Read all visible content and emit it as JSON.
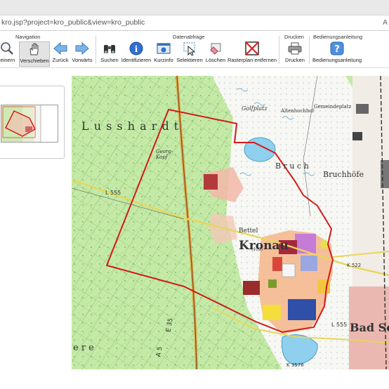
{
  "browser": {
    "url": "kro.jsp?project=kro_public&view=kro_public",
    "reader_icon": "A"
  },
  "toolbar": {
    "groups": {
      "navigation": "Navigation",
      "datenabfrage": "Datenabfrage",
      "drucken": "Drucken",
      "bedienungsanleitung": "Bedienungsanleitung"
    },
    "tools": {
      "verkleinern": "leinern",
      "verschieben": "Verschieben",
      "zurueck": "Zurück",
      "vorwaerts": "Vorwärts",
      "suchen": "Suchen",
      "identifizieren": "Identifizieren",
      "kurzinfo": "Kurzinfo",
      "selektieren": "Selektieren",
      "loeschen": "Löschen",
      "rasterplan": "Rasterplan entfernen",
      "drucken": "Drucken",
      "anleitung": "Bedienungsanleitung"
    }
  },
  "map": {
    "labels": {
      "lusshardt": "L u s s h a r d t",
      "kronau": "Kronau",
      "bad_schoenborn": "Bad Sch",
      "bruch": "B r u c h",
      "bruchhoefe": "Bruchhöfe",
      "golfplatz": "Golfplatz",
      "gemeindeplatz": "Gemeindeplatz",
      "althochhof": "Altenhochhof",
      "fuchskopf": "Georg-\nKopf",
      "bettel": "Bettel",
      "l555_north": "L 555",
      "l555_south": "L 555",
      "k3576": "K 3576",
      "a5": "A 5",
      "e35": "E 35",
      "b522": "K 522",
      "ere": "e r e",
      "elev": "(109)"
    }
  }
}
